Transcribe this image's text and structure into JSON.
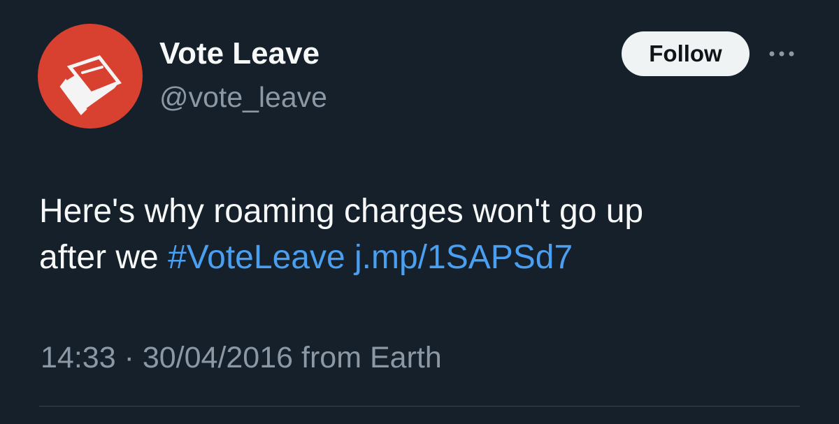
{
  "account": {
    "display_name": "Vote Leave",
    "handle": "@vote_leave",
    "avatar_icon": "vote-leave-ballot-box-logo",
    "avatar_color": "#d8412f"
  },
  "actions": {
    "follow_label": "Follow",
    "more_icon": "more-dots-icon"
  },
  "tweet": {
    "text_line1": "Here's why roaming charges won't go up",
    "text_line2_prefix": "after we ",
    "hashtag": "#VoteLeave",
    "link": "j.mp/1SAPSd7"
  },
  "meta": {
    "time": "14:33",
    "separator": "·",
    "date": "30/04/2016",
    "source": "from Earth"
  },
  "colors": {
    "background": "#15202b",
    "link": "#4a9ff0",
    "secondary_text": "#8b98a5"
  }
}
